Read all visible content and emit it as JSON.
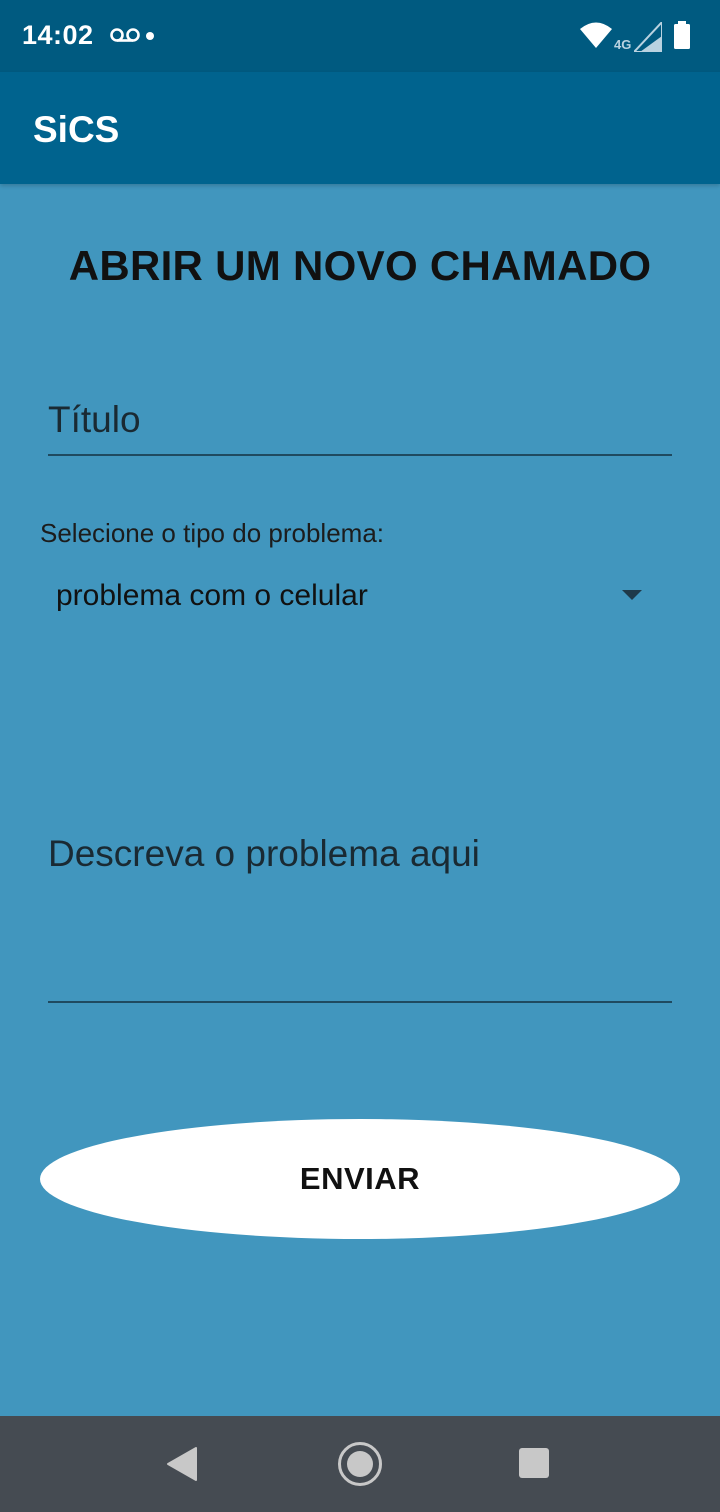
{
  "status_bar": {
    "time": "14:02",
    "network": "4G",
    "icons": [
      "voicemail-icon",
      "notification-dot-icon",
      "wifi-icon",
      "signal-icon",
      "battery-icon"
    ]
  },
  "app_bar": {
    "title": "SiCS"
  },
  "form": {
    "heading": "ABRIR UM NOVO CHAMADO",
    "title_placeholder": "Título",
    "problem_type_label": "Selecione o tipo do problema:",
    "problem_type_selected": "problema com o celular",
    "description_placeholder": "Descreva o problema aqui",
    "submit_label": "ENVIAR"
  },
  "nav_bar": {
    "icons": [
      "back-icon",
      "home-icon",
      "recents-icon"
    ]
  },
  "colors": {
    "status_bar": "#005a80",
    "app_bar": "#00638e",
    "background": "#4196be",
    "button": "#ffffff",
    "nav_bar": "#454b52"
  }
}
